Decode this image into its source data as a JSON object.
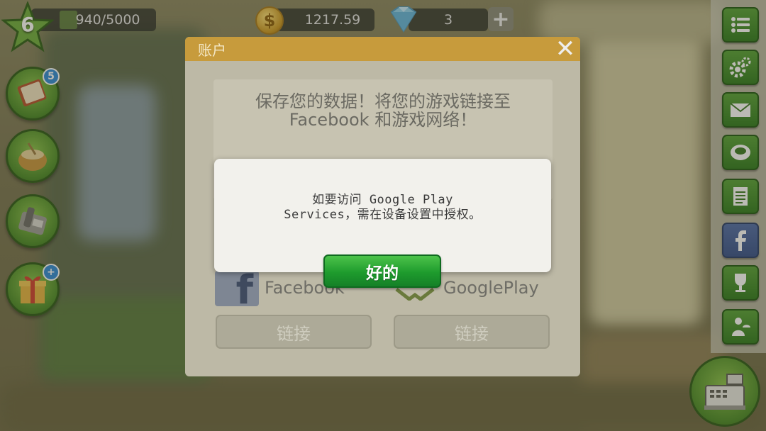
{
  "hud": {
    "level": "6",
    "xp_text": "940/5000",
    "xp_progress": 0.188,
    "coins": "1217.59",
    "gems": "3",
    "coin_glyph": "$",
    "plus_glyph": "+"
  },
  "left_buttons": [
    {
      "icon": "recipe-book-icon",
      "badge": "5"
    },
    {
      "icon": "flour-sack-icon"
    },
    {
      "icon": "phone-icon"
    },
    {
      "icon": "gift-box-icon",
      "badge": "+"
    }
  ],
  "right_buttons": [
    {
      "icon": "list-menu-icon"
    },
    {
      "icon": "settings-gears-icon"
    },
    {
      "icon": "mail-icon"
    },
    {
      "icon": "food-bowl-icon"
    },
    {
      "icon": "notes-icon"
    },
    {
      "icon": "facebook-icon"
    },
    {
      "icon": "trophy-icon"
    },
    {
      "icon": "waiter-icon"
    }
  ],
  "account_dialog": {
    "title": "账户",
    "close_glyph": "✕",
    "message_line1": "保存您的数据！将您的游戏链接至",
    "message_line2": "Facebook 和游戏网络！",
    "facebook_label": "Facebook",
    "googleplay_label": "GooglePlay",
    "facebook_connect": "链接",
    "googleplay_connect": "链接",
    "facebook_glyph": "f"
  },
  "alert": {
    "message_line1": "如要访问 Google Play",
    "message_line2": "Services，需在设备设置中授权。",
    "ok_label": "好的"
  },
  "colors": {
    "ok_button": "#1e9b2d",
    "dialog_header": "#c79b3c",
    "alert_bg": "#f2f1ec"
  }
}
